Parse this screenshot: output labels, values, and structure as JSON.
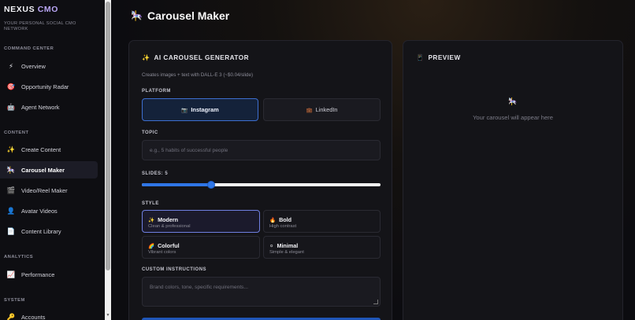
{
  "sidebar": {
    "brand_a": "NEXUS",
    "brand_b": "CMO",
    "tagline": "YOUR PERSONAL SOCIAL CMO NETWORK",
    "sections": [
      {
        "title": "COMMAND CENTER"
      },
      {
        "title": "CONTENT"
      },
      {
        "title": "ANALYTICS"
      },
      {
        "title": "SYSTEM"
      }
    ],
    "items": [
      {
        "label": "Overview",
        "icon": "lightning-icon",
        "glyph": "⚡"
      },
      {
        "label": "Opportunity Radar",
        "icon": "target-icon",
        "glyph": "🎯"
      },
      {
        "label": "Agent Network",
        "icon": "robot-icon",
        "glyph": "🤖"
      },
      {
        "label": "Create Content",
        "icon": "sparkles-icon",
        "glyph": "✨"
      },
      {
        "label": "Carousel Maker",
        "icon": "carousel-horse-icon",
        "glyph": "🎠"
      },
      {
        "label": "Video/Reel Maker",
        "icon": "film-icon",
        "glyph": "🎬"
      },
      {
        "label": "Avatar Videos",
        "icon": "person-icon",
        "glyph": "👤"
      },
      {
        "label": "Content Library",
        "icon": "page-icon",
        "glyph": "📄"
      },
      {
        "label": "Performance",
        "icon": "chart-icon",
        "glyph": "📈"
      },
      {
        "label": "Accounts",
        "icon": "key-icon",
        "glyph": "🔑"
      }
    ]
  },
  "header": {
    "title": "Carousel Maker",
    "icon": "🎠"
  },
  "generator": {
    "icon": "✨",
    "title": "AI CAROUSEL GENERATOR",
    "subtitle": "Creates images + text with DALL-E 3 (~$0.04/slide)",
    "platform_label": "PLATFORM",
    "platforms": [
      {
        "label": "Instagram",
        "icon": "📷",
        "selected": true
      },
      {
        "label": "LinkedIn",
        "icon": "💼",
        "selected": false
      }
    ],
    "topic_label": "TOPIC",
    "topic_placeholder": "e.g., 5 habits of successful people",
    "slides_label": "SLIDES: 5",
    "slides_value": 5,
    "slides_fraction": 0.29,
    "style_label": "STYLE",
    "styles": [
      {
        "name": "Modern",
        "desc": "Clean & professional",
        "icon": "✨",
        "selected": true
      },
      {
        "name": "Bold",
        "desc": "High contrast",
        "icon": "🔥",
        "selected": false
      },
      {
        "name": "Colorful",
        "desc": "Vibrant colors",
        "icon": "🌈",
        "selected": false
      },
      {
        "name": "Minimal",
        "desc": "Simple & elegant",
        "icon": "⚪",
        "selected": false
      }
    ],
    "custom_label": "CUSTOM INSTRUCTIONS",
    "custom_placeholder": "Brand colors, tone, specific requirements..."
  },
  "preview": {
    "icon": "📱",
    "title": "PREVIEW",
    "empty_icon": "🎠",
    "empty_text": "Your carousel will appear here"
  },
  "colors": {
    "accent": "#2f76e6",
    "brand": "#b9a6f5"
  }
}
